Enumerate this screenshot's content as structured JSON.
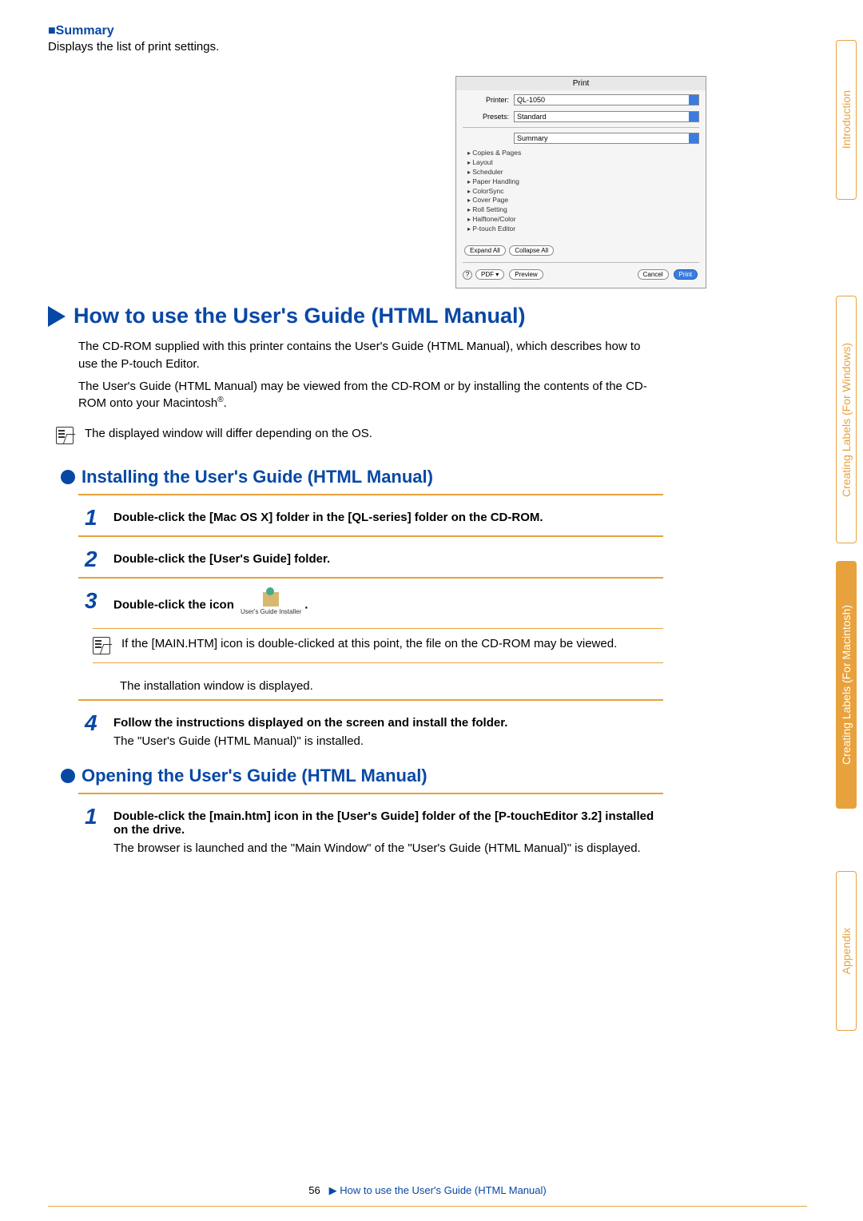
{
  "summary": {
    "label": "■Summary",
    "desc": "Displays the list of print settings."
  },
  "print_dialog": {
    "title": "Print",
    "rows": {
      "printer_label": "Printer:",
      "printer_value": "QL-1050",
      "presets_label": "Presets:",
      "presets_value": "Standard",
      "summary_value": "Summary"
    },
    "list": [
      "Copies & Pages",
      "Layout",
      "Scheduler",
      "Paper Handling",
      "ColorSync",
      "Cover Page",
      "Roll Setting",
      "Halftone/Color",
      "P-touch Editor"
    ],
    "expand": "Expand All",
    "collapse": "Collapse All",
    "help": "?",
    "pdf": "PDF ▾",
    "preview": "Preview",
    "cancel": "Cancel",
    "print": "Print"
  },
  "section1": {
    "title": "How to use the User's Guide (HTML Manual)",
    "p1": "The CD-ROM supplied with this printer contains the User's Guide (HTML Manual), which describes how to use the P-touch Editor.",
    "p2a": "The User's Guide (HTML Manual) may be viewed from the CD-ROM or by installing the contents of the CD-ROM onto your Macintosh",
    "p2sup": "®",
    "p2b": ".",
    "note": "The  displayed window will differ depending on the OS."
  },
  "installing": {
    "title": "Installing the User's Guide (HTML Manual)",
    "step1": "Double-click the [Mac OS X] folder in the [QL-series] folder on the CD-ROM.",
    "step2": "Double-click the [User's Guide] folder.",
    "step3a": "Double-click the icon",
    "step3caption": "User's Guide Installer",
    "step3b": ".",
    "note": "If the [MAIN.HTM] icon is double-clicked at this point, the file on the CD-ROM may be viewed.",
    "after_note": "The installation window is displayed.",
    "step4a": "Follow the instructions displayed on the screen and install the folder.",
    "step4b": "The \"User's Guide (HTML Manual)\" is installed."
  },
  "opening": {
    "title": "Opening the User's Guide (HTML Manual)",
    "step1a": "Double-click the [main.htm] icon in the [User's Guide] folder of the [P-touchEditor 3.2] installed on the drive.",
    "step1b": "The browser is launched and the \"Main Window\" of the \"User's Guide (HTML Manual)\" is displayed."
  },
  "footer": {
    "page": "56",
    "crumb": "How to use the User's Guide (HTML Manual)"
  },
  "tabs": {
    "intro": "Introduction",
    "windows": "Creating Labels (For Windows)",
    "mac": "Creating Labels (For Macintosh)",
    "appendix": "Appendix"
  }
}
